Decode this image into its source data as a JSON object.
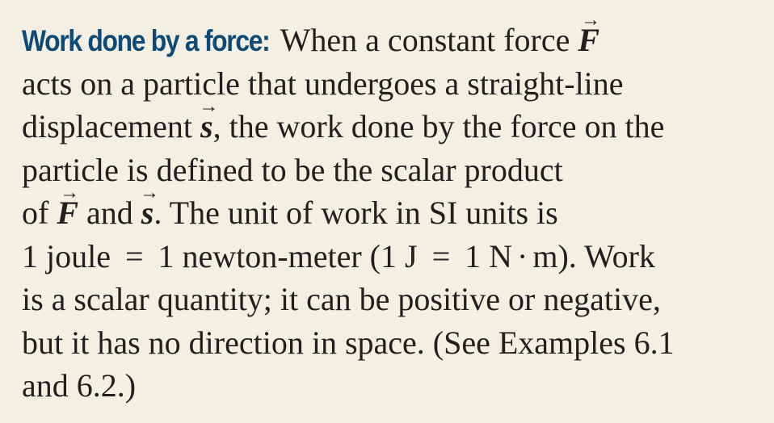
{
  "box": {
    "heading": "Work done by a force:",
    "vector_symbols": {
      "force": "F",
      "displacement": "s",
      "arrow": "→"
    },
    "text": {
      "l1": "When a constant force",
      "l2": "acts on a particle that undergoes a straight-line",
      "l3a": "displacement",
      "l3b": ", the work done by the force on the",
      "l4": "particle is defined to be the scalar product",
      "l5a": "of",
      "l5b": "and",
      "l5c": ". The unit of work in SI units is",
      "l6a": "1 joule",
      "l6eq1": "=",
      "l6b": "1 newton-meter (1 J",
      "l6eq2": "=",
      "l6c": "1 N",
      "l6dot": "·",
      "l6d": "m). Work",
      "l7": "is a scalar quantity; it can be positive or negative,",
      "l8": "but it has no direction in space. (See Examples 6.1",
      "l9": "and 6.2.)"
    },
    "colors": {
      "background": "#f3efe3",
      "heading": "#0d4a78",
      "text": "#231f20"
    }
  }
}
